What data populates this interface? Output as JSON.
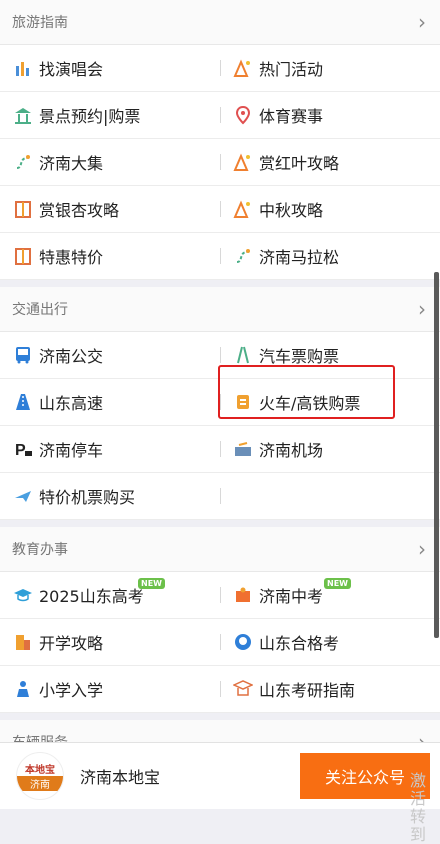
{
  "sections": [
    {
      "title": "旅游指南",
      "rows": [
        [
          {
            "label": "找演唱会",
            "icon": "concert-icon"
          },
          {
            "label": "热门活动",
            "icon": "activity-icon"
          }
        ],
        [
          {
            "label": "景点预约|购票",
            "icon": "scenic-icon"
          },
          {
            "label": "体育赛事",
            "icon": "location-pin-icon"
          }
        ],
        [
          {
            "label": "济南大集",
            "icon": "route-icon"
          },
          {
            "label": "赏红叶攻略",
            "icon": "activity-icon"
          }
        ],
        [
          {
            "label": "赏银杏攻略",
            "icon": "guide-book-icon"
          },
          {
            "label": "中秋攻略",
            "icon": "activity-icon"
          }
        ],
        [
          {
            "label": "特惠特价",
            "icon": "guide-book-icon"
          },
          {
            "label": "济南马拉松",
            "icon": "route-icon"
          }
        ]
      ]
    },
    {
      "title": "交通出行",
      "rows": [
        [
          {
            "label": "济南公交",
            "icon": "bus-icon"
          },
          {
            "label": "汽车票购票",
            "icon": "road-icon"
          }
        ],
        [
          {
            "label": "山东高速",
            "icon": "highway-icon"
          },
          {
            "label": "火车/高铁购票",
            "icon": "train-ticket-icon"
          }
        ],
        [
          {
            "label": "济南停车",
            "icon": "parking-icon"
          },
          {
            "label": "济南机场",
            "icon": "airport-icon"
          }
        ],
        [
          {
            "label": "特价机票购买",
            "icon": "plane-icon"
          },
          {
            "label": "",
            "icon": ""
          }
        ]
      ]
    },
    {
      "title": "教育办事",
      "rows": [
        [
          {
            "label": "2025山东高考",
            "icon": "graduation-cap-icon",
            "badge": "NEW"
          },
          {
            "label": "济南中考",
            "icon": "exam-icon",
            "badge": "NEW"
          }
        ],
        [
          {
            "label": "开学攻略",
            "icon": "school-building-icon"
          },
          {
            "label": "山东合格考",
            "icon": "student-icon"
          }
        ],
        [
          {
            "label": "小学入学",
            "icon": "child-icon"
          },
          {
            "label": "山东考研指南",
            "icon": "graduate-icon"
          }
        ]
      ]
    },
    {
      "title": "车辆服务",
      "rows": []
    }
  ],
  "footer": {
    "logo_top": "本地宝",
    "logo_bottom": "济南",
    "brand": "济南本地宝",
    "follow_label": "关注公众号"
  },
  "watermark": "激活\n转到",
  "colors": {
    "accent": "#f86e12",
    "highlight": "#e02020",
    "badge": "#6cc04a"
  }
}
